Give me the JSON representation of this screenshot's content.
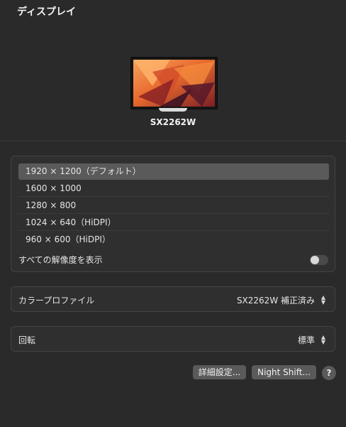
{
  "header": {
    "title": "ディスプレイ"
  },
  "display": {
    "name": "SX2262W"
  },
  "resolutions": {
    "items": [
      "1920 × 1200（デフォルト）",
      "1600 × 1000",
      "1280 × 800",
      "1024 × 640（HiDPI）",
      "960 × 600（HiDPI）"
    ],
    "selected_index": 0,
    "show_all_label": "すべての解像度を表示",
    "show_all_enabled": false
  },
  "color_profile": {
    "label": "カラープロファイル",
    "value": "SX2262W 補正済み"
  },
  "rotation": {
    "label": "回転",
    "value": "標準"
  },
  "buttons": {
    "advanced": "詳細設定...",
    "night_shift": "Night Shift...",
    "help": "?"
  },
  "colors": {
    "accent_bg": "#2a2a2a",
    "selection": "#5a5a5a",
    "panel": "#2f2f2f"
  }
}
